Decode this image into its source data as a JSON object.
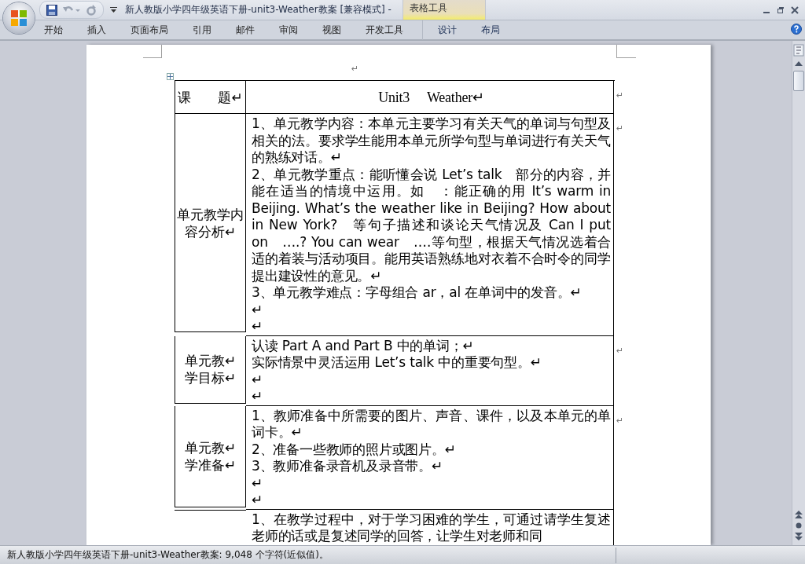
{
  "title_bar": {
    "title": "新人教版小学四年级英语下册-unit3-Weather教案 [兼容模式] -",
    "contextual_group": "表格工具"
  },
  "ribbon_tabs": [
    {
      "label": "开始",
      "selected": false
    },
    {
      "label": "插入",
      "selected": false
    },
    {
      "label": "页面布局",
      "selected": false
    },
    {
      "label": "引用",
      "selected": false
    },
    {
      "label": "邮件",
      "selected": false
    },
    {
      "label": "审阅",
      "selected": false
    },
    {
      "label": "视图",
      "selected": false
    },
    {
      "label": "开发工具",
      "selected": false
    },
    {
      "label": "设计",
      "selected": false,
      "contextual": true
    },
    {
      "label": "布局",
      "selected": false,
      "contextual": true
    }
  ],
  "document": {
    "top_mark": "↵",
    "table": {
      "rows": [
        {
          "kind": "title",
          "heading": [
            "课　　题↵"
          ],
          "content": [
            "Unit3　 Weather↵"
          ],
          "end_mark": "↵"
        },
        {
          "kind": "body",
          "heading": [
            "单元教学内容分析↵"
          ],
          "content": [
            "1、单元教学内容：本单元主要学习有关天气的单词与句型及相关的法。要求学生能用本单元所学句型与单词进行有关天气的熟练对话。↵",
            "2、单元教学重点：能听懂会说 Let’s talk　部分的内容，并能在适当的情境中运用。如　：能正确的用 It’s warm in Beijing. What’s the weather like in Beijing? How about in New York?　等句子描述和谈论天气情况及 Can I put on　….? You can wear　….等句型，根据天气情况选着合适的着装与活动项目。能用英语熟练地对衣着不合时令的同学提出建设性的意见。↵",
            "3、单元教学难点：字母组合 ar，al 在单词中的发音。↵",
            "↵",
            "↵"
          ],
          "end_mark": "↵"
        },
        {
          "kind": "body",
          "heading": [
            "单元教↵",
            "学目标↵"
          ],
          "content": [
            "认读 Part A and Part B 中的单词；↵",
            "实际情景中灵活运用 Let’s talk 中的重要句型。↵",
            "↵",
            "↵"
          ],
          "end_mark": "↵"
        },
        {
          "kind": "body",
          "heading": [
            "单元教↵",
            "学准备↵"
          ],
          "content": [
            "1、教师准备中所需要的图片、声音、课件，以及本单元的单词卡。↵",
            "2、准备一些教师的照片或图片。↵",
            "3、教师准备录音机及录音带。↵",
            "↵",
            "↵"
          ],
          "end_mark": "↵"
        },
        {
          "kind": "body",
          "content": [
            "1、在教学过程中，对于学习困难的学生，可通过请学生复述老师的话或是复述同学的回答，让学生对老师和同"
          ]
        }
      ]
    }
  },
  "status_bar": {
    "text": "新人教版小学四年级英语下册-unit3-Weather教案: 9,048 个字符(近似值)。"
  }
}
